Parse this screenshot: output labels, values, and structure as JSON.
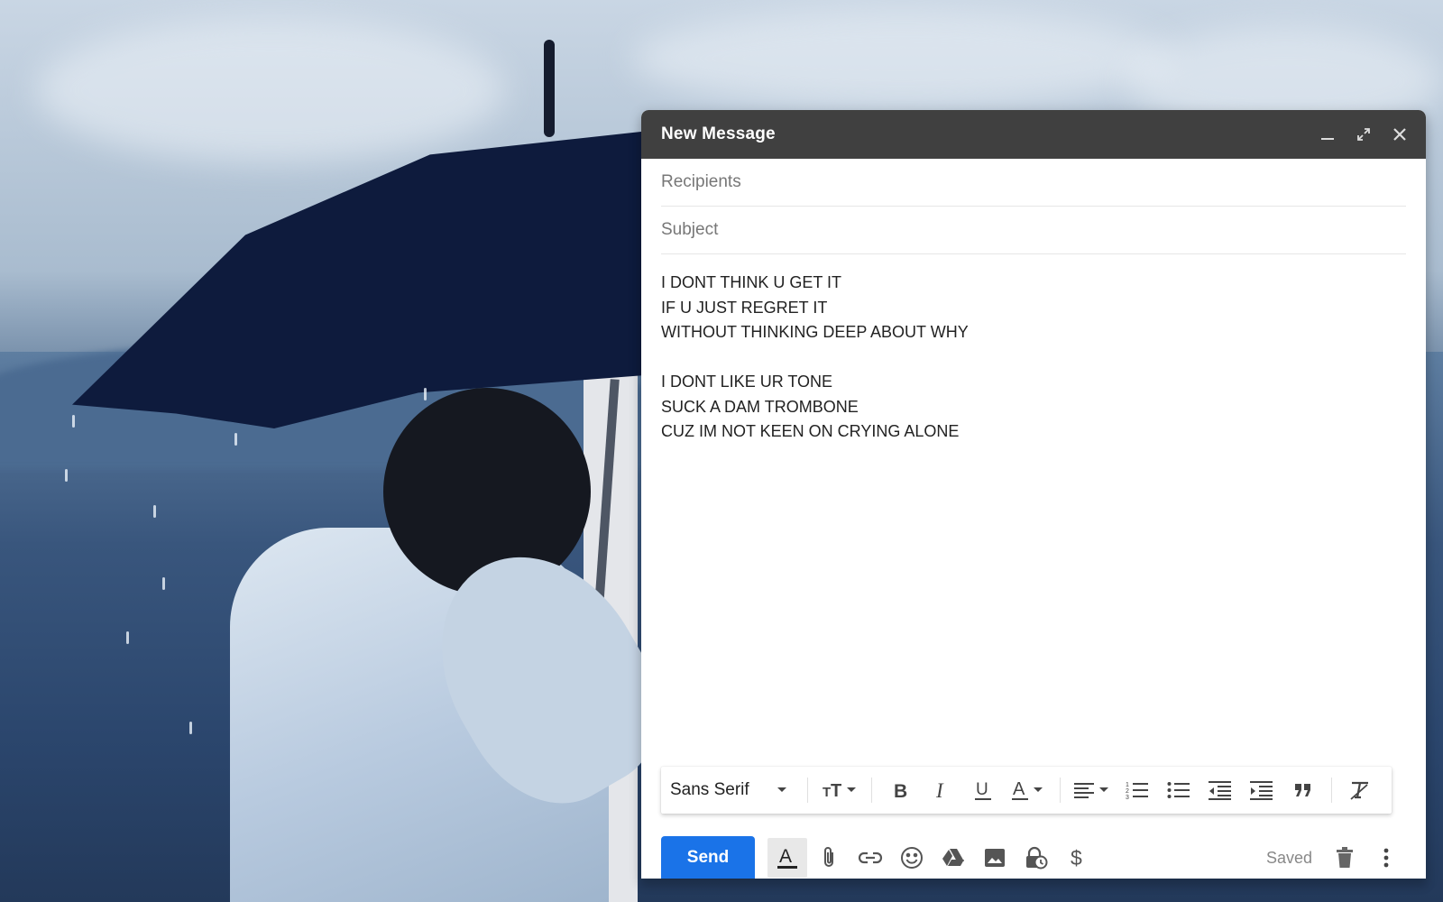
{
  "compose": {
    "title": "New Message",
    "recipients_placeholder": "Recipients",
    "subject_placeholder": "Subject",
    "body_lines": [
      "I DONT THINK U GET IT",
      "IF U JUST REGRET IT",
      "WITHOUT THINKING DEEP ABOUT WHY",
      "",
      "I DONT LIKE UR TONE",
      "SUCK A DAM TROMBONE",
      "CUZ IM NOT KEEN ON CRYING ALONE"
    ],
    "header_icons": [
      "minimize-icon",
      "expand-icon",
      "close-icon"
    ]
  },
  "format_toolbar": {
    "font_family": "Sans Serif",
    "buttons": [
      "text-size-icon",
      "bold-icon",
      "italic-icon",
      "underline-icon",
      "text-color-icon",
      "align-icon",
      "numbered-list-icon",
      "bulleted-list-icon",
      "indent-less-icon",
      "indent-more-icon",
      "quote-icon",
      "remove-formatting-icon"
    ]
  },
  "action_bar": {
    "send_label": "Send",
    "saved_label": "Saved",
    "icons": [
      "formatting-options-icon",
      "attach-icon",
      "link-icon",
      "emoji-icon",
      "drive-icon",
      "photo-icon",
      "confidential-icon",
      "money-icon",
      "trash-icon",
      "more-options-icon"
    ]
  },
  "colors": {
    "header_bg": "#404040",
    "send_button": "#1a73e8",
    "toolbar_icon": "#444444"
  }
}
